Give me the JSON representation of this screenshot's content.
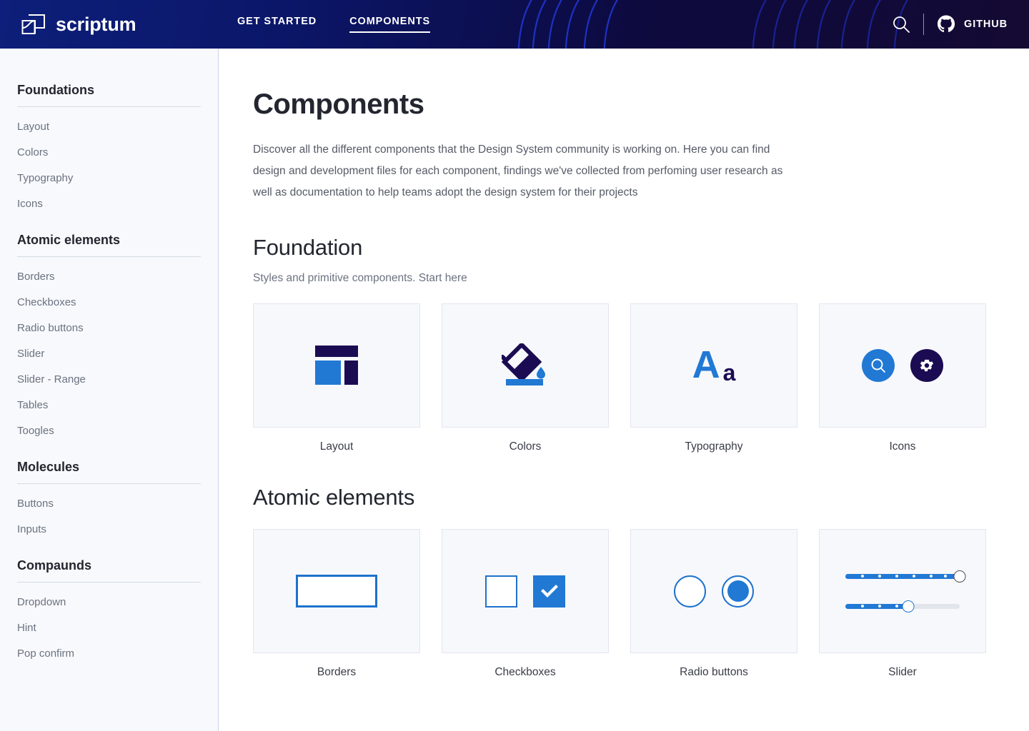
{
  "header": {
    "brand": "scriptum",
    "brand_icon": "cube-logo-icon",
    "nav": [
      {
        "label": "GET STARTED",
        "active": false
      },
      {
        "label": "COMPONENTS",
        "active": true
      }
    ],
    "search_icon": "search-icon",
    "github_icon": "github-icon",
    "github_label": "GITHUB"
  },
  "sidebar": {
    "groups": [
      {
        "title": "Foundations",
        "items": [
          "Layout",
          "Colors",
          "Typography",
          "Icons"
        ]
      },
      {
        "title": "Atomic elements",
        "items": [
          "Borders",
          "Checkboxes",
          "Radio buttons",
          "Slider",
          "Slider - Range",
          "Tables",
          "Toogles"
        ]
      },
      {
        "title": "Molecules",
        "items": [
          "Buttons",
          "Inputs"
        ]
      },
      {
        "title": "Compaunds",
        "items": [
          "Dropdown",
          "Hint",
          "Pop confirm"
        ]
      }
    ]
  },
  "main": {
    "title": "Components",
    "description": "Discover all the different components that the Design System community is working on. Here you can find design and development files for each component, findings we've collected from perfoming user research as well as documentation to help teams adopt the design system for their projects",
    "sections": [
      {
        "title": "Foundation",
        "subtitle": "Styles and primitive components. Start here",
        "cards": [
          {
            "label": "Layout",
            "icon": "layout-thumbnail-icon"
          },
          {
            "label": "Colors",
            "icon": "paint-bucket-icon"
          },
          {
            "label": "Typography",
            "icon": "typography-aa-icon"
          },
          {
            "label": "Icons",
            "icon": "icon-set-icon"
          }
        ]
      },
      {
        "title": "Atomic elements",
        "subtitle": "",
        "cards": [
          {
            "label": "Borders",
            "icon": "border-box-icon"
          },
          {
            "label": "Checkboxes",
            "icon": "checkbox-pair-icon"
          },
          {
            "label": "Radio buttons",
            "icon": "radio-pair-icon"
          },
          {
            "label": "Slider",
            "icon": "slider-pair-icon"
          }
        ]
      }
    ]
  },
  "colors": {
    "header_start": "#0d1f7a",
    "header_end": "#140a33",
    "accent_blue": "#2179d4",
    "accent_navy": "#1b0b52",
    "sidebar_bg": "#f7f9fc",
    "card_bg": "#f7f8fc",
    "text_dark": "#23262f",
    "text_muted": "#6b7280"
  },
  "slider_values": {
    "top_percent": 100,
    "bottom_percent": 55
  }
}
